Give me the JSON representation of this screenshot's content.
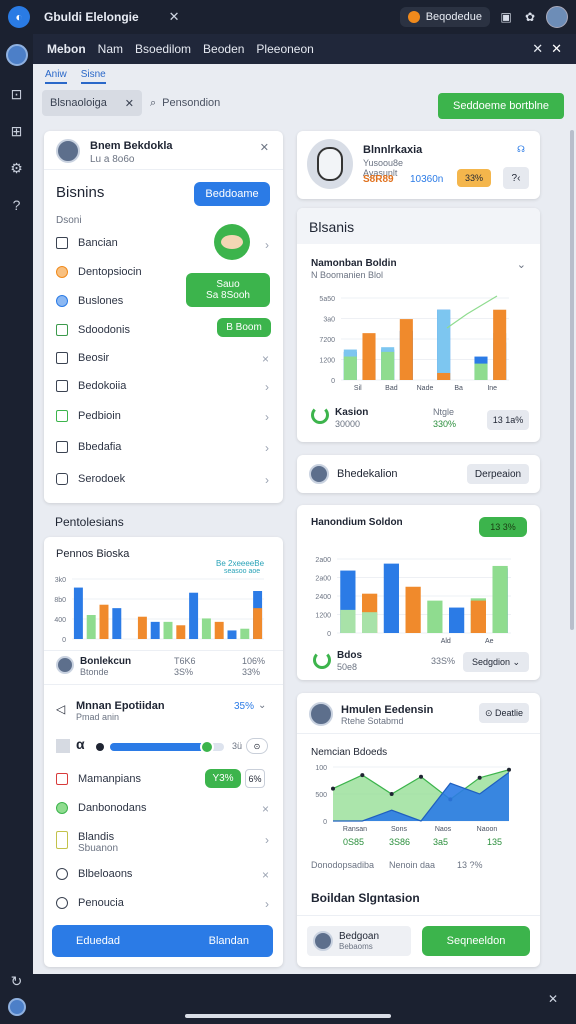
{
  "topbar": {
    "title": "Gbuldi Elelongie",
    "close": "✕",
    "pill_label": "Beqodedue",
    "icons": [
      "window-icon",
      "palette-icon"
    ]
  },
  "nav": {
    "tabs": [
      "Mebon",
      "Nam",
      "Bsoedilom",
      "Beoden",
      "Pleeoneon"
    ],
    "close": "✕",
    "close2": "✕"
  },
  "subtabs": [
    "Aniw",
    "Sisne"
  ],
  "toolbar": {
    "chip_label": "Blsnaoloiga",
    "chip_close": "✕",
    "search_label": "Pensondion",
    "action_button": "Seddoeme bortblne"
  },
  "left_card": {
    "profile_name": "Bnem Bekdokla",
    "profile_sub": "Lu a 8o6o",
    "title": "Bisnins",
    "primary_button": "Beddoame",
    "section": "Dsoni",
    "items": [
      {
        "label": "Bancian",
        "icon": "list-icon"
      },
      {
        "label": "Dentopsiocin",
        "icon": "orange-dot-icon"
      },
      {
        "label": "Buslones",
        "icon": "blue-dot-icon"
      },
      {
        "label": "Sdoodonis",
        "icon": "grid-icon"
      },
      {
        "label": "Beosir",
        "icon": "terminal-icon"
      },
      {
        "label": "Bedokoiia",
        "icon": "folder-icon"
      },
      {
        "label": "Pedbioin",
        "icon": "green-box-icon"
      },
      {
        "label": "Bbedafia",
        "icon": "chat-icon"
      },
      {
        "label": "Serodoek",
        "icon": "square-icon"
      }
    ],
    "green_card": {
      "line1": "Sauo",
      "line2": "Sa 8Sooh"
    },
    "small_green": "B Boom"
  },
  "section_heading": "Pentolesians",
  "left_card2": {
    "title": "Pennos Bioska",
    "legend_text": "Be 2xeeeeBe",
    "legend2": "seasoo aoe",
    "chart_data": {
      "type": "bar",
      "ylim": [
        0,
        3500
      ],
      "yticks": [
        "0",
        "400",
        "8b0",
        "3k0"
      ],
      "series": [
        {
          "values": [
            3000,
            0,
            0,
            1800,
            0,
            0,
            1000,
            0,
            0,
            2700,
            0,
            0,
            500,
            0,
            2800
          ],
          "color": "#2b7be6"
        },
        {
          "values": [
            0,
            1400,
            0,
            0,
            0,
            0,
            0,
            1000,
            0,
            0,
            1200,
            0,
            0,
            600,
            0
          ],
          "color": "#8fdc8f"
        },
        {
          "values": [
            0,
            0,
            2000,
            0,
            0,
            1300,
            0,
            0,
            800,
            0,
            0,
            1000,
            0,
            0,
            1800
          ],
          "color": "#f08a2c"
        }
      ]
    },
    "stats": {
      "name": "Bonlekcun",
      "sub": "Btonde",
      "v1": "T6K6",
      "v1b": "3S%",
      "v2": "106%",
      "v2b": "33%"
    },
    "progress_title": "Mnnan Epotiidan",
    "progress_sub": "Pmad anin",
    "progress_pct": "35%",
    "slider_value": 0.85,
    "slider_label": "3ü",
    "items": [
      {
        "label": "Mamanpians",
        "icon": "red-box-icon"
      },
      {
        "label": "Danbonodans",
        "icon": "green-dot-icon"
      },
      {
        "label": "Blandis",
        "sub": "Sbuanon",
        "icon": "yellow-box-icon"
      },
      {
        "label": "Blbeloaons",
        "icon": "circle-icon"
      },
      {
        "label": "Penoucia",
        "icon": "clock-icon"
      }
    ],
    "tag1": "Y3%",
    "tag2": "6%",
    "footer_left": "Eduedad",
    "footer_right": "Blandan"
  },
  "right_profile": {
    "name": "Blnnlrkaxia",
    "sub1": "Yusoou8e",
    "sub2": "Ayasunlt",
    "v1": "S8R89",
    "v2": "10360n",
    "badge": "33%",
    "mini": "☊"
  },
  "right_chart1": {
    "card_title": "Blsanis",
    "title": "Namonban Boldin",
    "subtitle": "N Boomanien Blol",
    "chart_data": {
      "type": "bar",
      "ylim": [
        0,
        3500
      ],
      "yticks": [
        "0",
        "1200",
        "7200",
        "3a0",
        "5a50"
      ],
      "xticks": [
        "Sil",
        "Bad",
        "Nade",
        "Ba",
        "Ine"
      ],
      "series": [
        {
          "name": "A",
          "values": [
            1200,
            900,
            1300,
            2100,
            0,
            3000,
            0,
            1000,
            1600
          ],
          "color": "#2b7be6"
        },
        {
          "name": "B",
          "values": [
            1300,
            0,
            1400,
            0,
            0,
            3000,
            0,
            0,
            2000
          ],
          "color": "#7dc6f0"
        },
        {
          "name": "C",
          "values": [
            0,
            2000,
            0,
            2600,
            0,
            300,
            0,
            0,
            3000
          ],
          "color": "#f08a2c"
        },
        {
          "name": "D",
          "values": [
            1000,
            0,
            1200,
            0,
            0,
            0,
            0,
            700,
            0
          ],
          "color": "#8fdc8f"
        }
      ]
    },
    "foot_label": "Kasion",
    "foot_value": "30000",
    "foot_mid": "Ntgle",
    "foot_mid_v": "330%",
    "foot_btn": "13 1a%"
  },
  "right_user": {
    "name": "Bhedekalion",
    "button": "Derpeaion"
  },
  "right_chart2": {
    "title": "Hanondium Soldon",
    "badge": "13 3%",
    "chart_data": {
      "type": "bar",
      "ylim": [
        0,
        3200
      ],
      "yticks": [
        "0",
        "1200",
        "2400",
        "2a00",
        "2a00"
      ],
      "xticks": [
        "",
        "",
        "Ald",
        "Ae"
      ],
      "series": [
        {
          "values": [
            2700,
            0,
            3000,
            0,
            0,
            1100,
            0,
            2800
          ],
          "color": "#2b7be6"
        },
        {
          "values": [
            0,
            0,
            0,
            0,
            1400,
            0,
            1500,
            2900
          ],
          "color": "#8fdc8f"
        },
        {
          "values": [
            0,
            1700,
            0,
            2000,
            0,
            0,
            1400,
            0
          ],
          "color": "#f08a2c"
        },
        {
          "values": [
            1000,
            900,
            0,
            0,
            0,
            0,
            0,
            0
          ],
          "color": "#a8e2a8"
        }
      ]
    },
    "foot_label": "Bdos",
    "foot_value": "50e8",
    "foot_mid": "33S%",
    "foot_btn": "Sedgdion"
  },
  "right_user2": {
    "name": "Hmulen Eedensin",
    "sub": "Rtehe Sotabmd",
    "button": "Deatlie"
  },
  "right_chart3": {
    "title": "Nemcian Bdoeds",
    "chart_data": {
      "type": "area",
      "ylim": [
        0,
        1000
      ],
      "yticks": [
        "0",
        "500",
        "100"
      ],
      "x": [
        "Ransan",
        "Sons",
        "Naos",
        "Naoon"
      ],
      "series": [
        {
          "values": [
            600,
            850,
            500,
            820,
            400,
            800,
            950
          ],
          "color": "#8fdc8f"
        },
        {
          "values": [
            0,
            0,
            200,
            0,
            700,
            500,
            900
          ],
          "color": "#2b7be6"
        }
      ]
    },
    "vals": [
      "0S85",
      "3S86",
      "3a5",
      "135"
    ],
    "foot_l": "Donodopsadiba",
    "foot_m": "Nenoin daa",
    "foot_r": "13 ?%"
  },
  "bottom_right": {
    "title": "Boildan Slgntasion",
    "profile": "Bedgoan",
    "profile_sub": "Bebaoms",
    "button": "Seqneeldon"
  },
  "colors": {
    "blue": "#2b7be6",
    "green": "#3cb44c",
    "orange": "#f08a2c"
  }
}
